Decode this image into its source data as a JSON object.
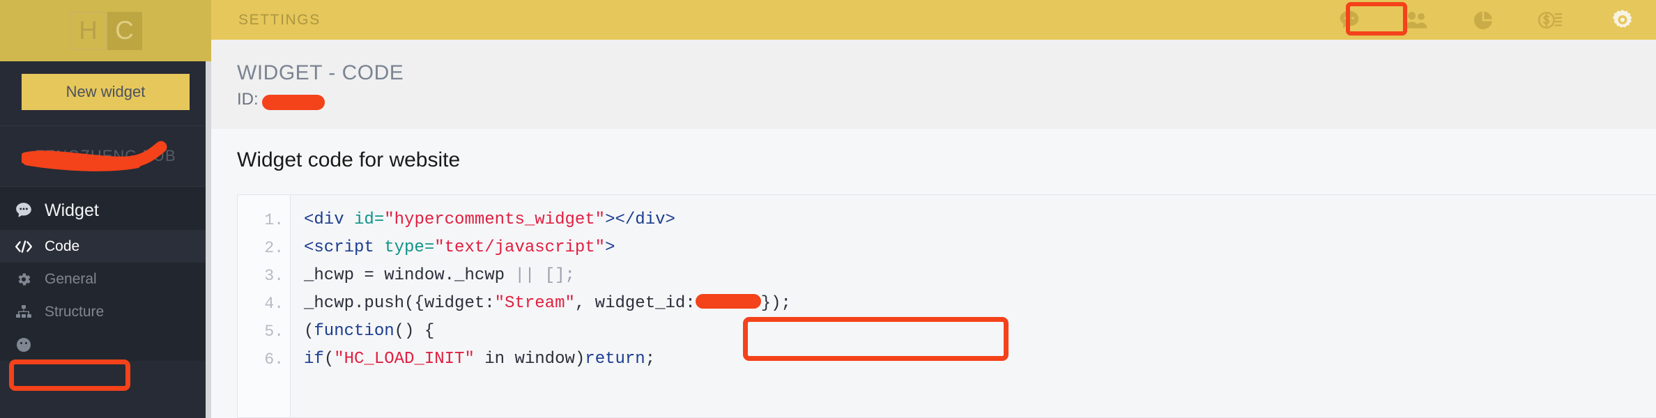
{
  "brand": {
    "logo_left": "H",
    "logo_right": "C"
  },
  "topbar": {
    "title": "SETTINGS",
    "icons": [
      {
        "name": "chat-icon",
        "label": "Comments"
      },
      {
        "name": "users-icon",
        "label": "Users"
      },
      {
        "name": "pie-chart-icon",
        "label": "Statistics"
      },
      {
        "name": "billing-icon",
        "label": "Billing"
      },
      {
        "name": "gear-icon",
        "label": "Settings"
      }
    ],
    "active_icon": "gear-icon"
  },
  "sidebar": {
    "new_widget_label": "New widget",
    "site_name": "FENGZHENG.PUB",
    "site_name_redacted": true,
    "section": {
      "icon": "chat-icon",
      "label": "Widget"
    },
    "items": [
      {
        "label": "Code",
        "icon": "code-icon",
        "active": true
      },
      {
        "label": "General",
        "icon": "gear-icon",
        "active": false
      },
      {
        "label": "Structure",
        "icon": "sitemap-icon",
        "active": false
      },
      {
        "label": "",
        "icon": "smiley-icon",
        "active": false
      }
    ]
  },
  "page": {
    "title": "WIDGET - CODE",
    "id_label": "ID:",
    "id_value": "",
    "id_redacted": true
  },
  "card": {
    "title": "Widget code for website"
  },
  "code": {
    "line_numbers": [
      "1.",
      "2.",
      "3.",
      "4.",
      "5.",
      "6."
    ],
    "lines": [
      {
        "n": "1.",
        "text": "<div id=\"hypercomments_widget\"></div>"
      },
      {
        "n": "2.",
        "text": "<script type=\"text/javascript\">"
      },
      {
        "n": "3.",
        "text": "_hcwp = window._hcwp || [];"
      },
      {
        "n": "4.",
        "text": "_hcwp.push({widget:\"Stream\", widget_id:██████});"
      },
      {
        "n": "5.",
        "text": "(function() {"
      },
      {
        "n": "6.",
        "text": "if(\"HC_LOAD_INIT\" in window)return;"
      }
    ],
    "tokens": {
      "l1_tag_open": "<div ",
      "l1_attr": "id=",
      "l1_str": "\"hypercomments_widget\"",
      "l1_tag_close": "></div>",
      "l2_tag_open": "<script ",
      "l2_attr": "type=",
      "l2_str": "\"text/javascript\"",
      "l2_tag_close": ">",
      "l3_a": "_hcwp = window._hcwp ",
      "l3_punc": "|| [];",
      "l4_a": "_hcwp.push({widget:",
      "l4_str": "\"Stream\"",
      "l4_b": ", widget_id:",
      "l4_c": "});",
      "l5_a": "(",
      "l5_kw": "function",
      "l5_b": "() {",
      "l6_kw": "if",
      "l6_a": "(",
      "l6_str": "\"HC_LOAD_INIT\"",
      "l6_b": " in window)",
      "l6_kw2": "return",
      "l6_c": ";"
    }
  },
  "annotations": {
    "highlight_color": "#f4421a",
    "boxes": [
      {
        "name": "settings-icon-highlight",
        "target": "gear-icon"
      },
      {
        "name": "code-nav-highlight",
        "target": "sidebar-item-code"
      },
      {
        "name": "widget-id-highlight",
        "target": "code-line-4-widget-id"
      }
    ],
    "redactions": [
      {
        "name": "site-name-redaction",
        "shape": "scribble"
      },
      {
        "name": "page-id-redaction",
        "shape": "pill"
      },
      {
        "name": "widget-id-redaction",
        "shape": "pill"
      }
    ]
  },
  "colors": {
    "sidebar_bg": "#272b35",
    "topbar_yellow": "#e6c75b",
    "logo_yellow": "#d1b84e",
    "highlight_red": "#f4421a",
    "main_bg": "#f0f0f0"
  }
}
